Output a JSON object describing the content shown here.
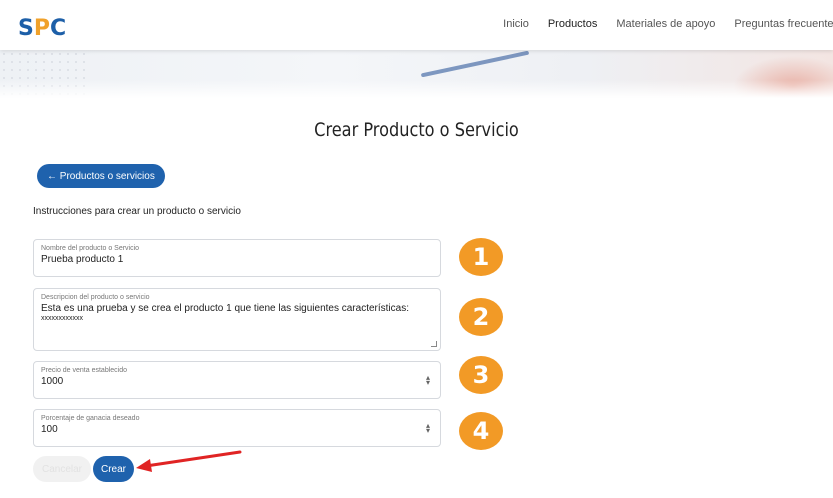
{
  "header": {
    "logo": {
      "s": "S",
      "p": "P",
      "c": "C"
    },
    "nav": [
      "Inicio",
      "Productos",
      "Materiales de apoyo",
      "Preguntas frecuentes"
    ],
    "active_nav": "Productos"
  },
  "page": {
    "title": "Crear Producto o Servicio",
    "back_label": "← Productos o servicios",
    "instructions": "Instrucciones para crear un producto o servicio"
  },
  "form": {
    "name": {
      "label": "Nombre del producto o Servicio",
      "value": "Prueba producto 1"
    },
    "description": {
      "label": "Descripcion del producto o servicio",
      "value": "Esta es una prueba y se crea el producto 1 que tiene las siguientes características:",
      "value_line2": "xxxxxxxxxxxx"
    },
    "price": {
      "label": "Precio de venta establecido",
      "value": "1000"
    },
    "margin": {
      "label": "Porcentaje de ganacia deseado",
      "value": "100"
    },
    "cancel_label": "Cancelar",
    "create_label": "Crear"
  },
  "annotations": {
    "steps": [
      "1",
      "2",
      "3",
      "4"
    ],
    "badge_color": "#f29a26",
    "arrow_color": "#e02424"
  },
  "colors": {
    "primary": "#1f62ad",
    "accent": "#f0a12a"
  }
}
